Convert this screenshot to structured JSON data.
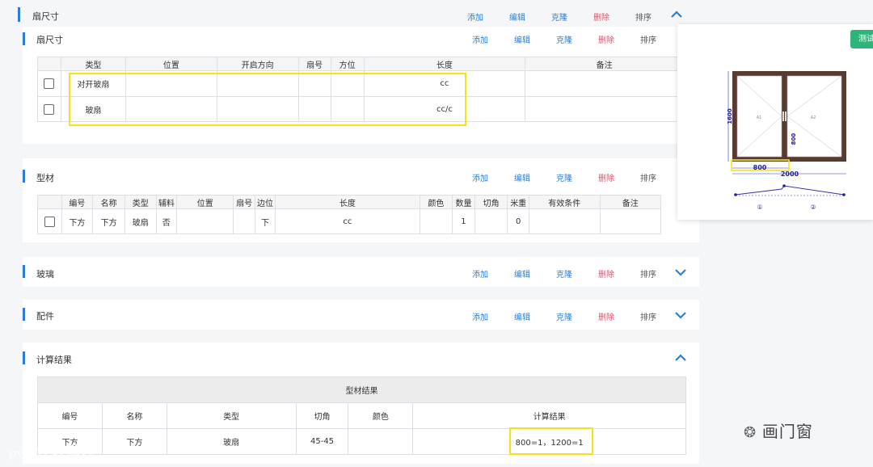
{
  "sections": {
    "sash_outer": {
      "title": "扇尺寸"
    },
    "sash": {
      "title": "扇尺寸"
    },
    "profile": {
      "title": "型材"
    },
    "glass": {
      "title": "玻璃"
    },
    "fittings": {
      "title": "配件"
    },
    "calc": {
      "title": "计算结果"
    }
  },
  "actions": {
    "add": "添加",
    "edit": "编辑",
    "clone": "克隆",
    "delete": "删除",
    "sort": "排序"
  },
  "sash_table": {
    "headers": [
      "类型",
      "位置",
      "开启方向",
      "扇号",
      "方位",
      "长度",
      "备注"
    ],
    "rows": [
      {
        "type": "对开玻扇",
        "position": "",
        "direction": "",
        "no": "",
        "orient": "",
        "length": "cc",
        "remark": ""
      },
      {
        "type": "玻扇",
        "position": "",
        "direction": "",
        "no": "",
        "orient": "",
        "length": "cc/c",
        "remark": ""
      }
    ]
  },
  "profile_table": {
    "headers": [
      "编号",
      "名称",
      "类型",
      "辅料",
      "位置",
      "扇号",
      "边位",
      "长度",
      "颜色",
      "数量",
      "切角",
      "米重",
      "有效条件",
      "备注"
    ],
    "rows": [
      {
        "code": "下方",
        "name": "下方",
        "type": "玻扇",
        "aux": "否",
        "position": "",
        "no": "",
        "edge": "下",
        "length": "cc",
        "color": "",
        "qty": "1",
        "angle": "",
        "weight": "0",
        "cond": "",
        "remark": ""
      }
    ]
  },
  "calc_table": {
    "caption": "型材结果",
    "headers": [
      "编号",
      "名称",
      "类型",
      "切角",
      "颜色",
      "计算结果"
    ],
    "rows": [
      {
        "code": "下方",
        "name": "下方",
        "type": "玻扇",
        "angle": "45-45",
        "color": "",
        "result": "800=1，1200=1"
      }
    ]
  },
  "preview": {
    "test_button": "测试",
    "dim_height": "1600",
    "dim_inner": "800",
    "dim_bottom_left": "800",
    "dim_total": "2000",
    "pane_left": "A1",
    "pane_right": "A2",
    "node1": "①",
    "node2": "②",
    "frame_color": "#5a3a30"
  },
  "watermarks": {
    "left": "大数跨境",
    "right": "画门窗"
  },
  "colors": {
    "accent": "#2a7fd4",
    "danger": "#e2506a",
    "highlight": "#f5e31a"
  }
}
